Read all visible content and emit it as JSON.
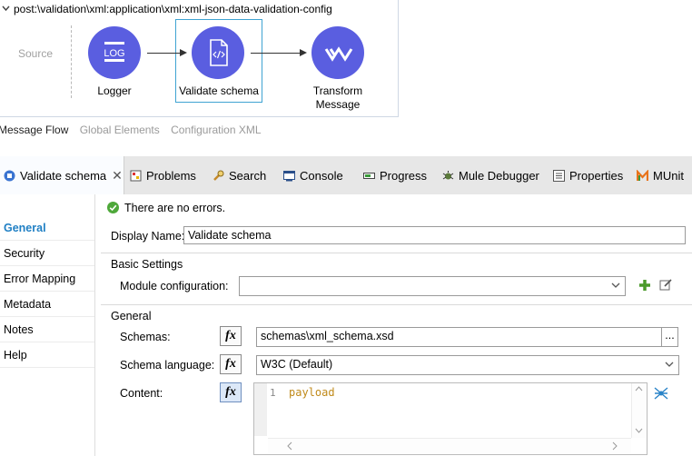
{
  "flow": {
    "path": "post:\\validation\\xml:application\\xml:xml-json-data-validation-config",
    "source_label": "Source",
    "nodes": [
      {
        "name": "Logger",
        "icon": "log-icon",
        "text": "LOG"
      },
      {
        "name": "Validate schema",
        "icon": "code-file-icon"
      },
      {
        "name": "Transform Message",
        "line1": "Transform",
        "line2": "Message",
        "icon": "transform-icon"
      }
    ],
    "node_color": "#5a5ee0"
  },
  "editor_tabs": [
    "Message Flow",
    "Global Elements",
    "Configuration XML"
  ],
  "view_tabs": [
    {
      "label": "Validate schema",
      "icon": "module-icon",
      "closable": true
    },
    {
      "label": "Problems",
      "icon": "problems-icon"
    },
    {
      "label": "Search",
      "icon": "search-icon"
    },
    {
      "label": "Console",
      "icon": "console-icon"
    },
    {
      "label": "Progress",
      "icon": "progress-icon"
    },
    {
      "label": "Mule Debugger",
      "icon": "debugger-icon"
    },
    {
      "label": "Properties",
      "icon": "properties-icon"
    },
    {
      "label": "MUnit",
      "icon": "munit-icon"
    }
  ],
  "nav": [
    "General",
    "Security",
    "Error Mapping",
    "Metadata",
    "Notes",
    "Help"
  ],
  "status": "There are no errors.",
  "form": {
    "display_name_label": "Display Name:",
    "display_name_value": "Validate schema",
    "basic_settings": "Basic Settings",
    "module_config_label": "Module configuration:",
    "module_config_value": "",
    "general_group": "General",
    "schemas_label": "Schemas:",
    "schemas_value": "schemas\\xml_schema.xsd",
    "schema_language_label": "Schema language:",
    "schema_language_value": "W3C (Default)",
    "content_label": "Content:",
    "content_line_no": "1",
    "content_code": "payload",
    "fx": "fx",
    "browse": "..."
  },
  "accent": "#1f7fc4"
}
